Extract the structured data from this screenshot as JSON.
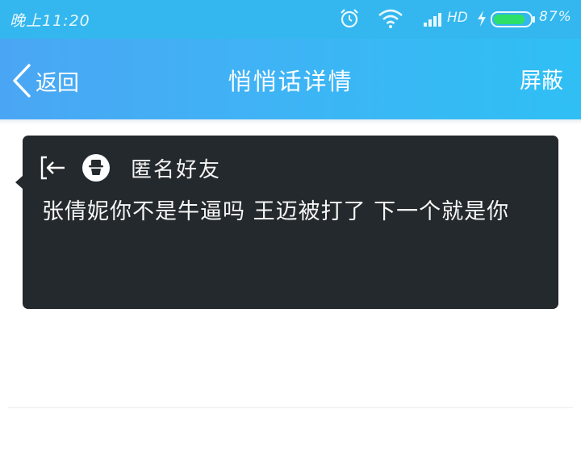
{
  "status_bar": {
    "time": "晚上11:20",
    "network": "HD",
    "battery_percent": "87%",
    "battery_level": 0.87,
    "icons": [
      "alarm-icon",
      "wifi-icon",
      "signal-icon",
      "charging-bolt-icon",
      "battery-icon"
    ]
  },
  "nav": {
    "back_label": "返回",
    "title": "悄悄话详情",
    "block_label": "屏蔽",
    "background": "#3fb3f5"
  },
  "message": {
    "sender": "匿名好友",
    "text": "张倩妮你不是牛逼吗 王迈被打了 下一个就是你",
    "card_color": "#24292d",
    "icons": [
      "exit-icon",
      "anonymous-avatar-icon"
    ]
  }
}
